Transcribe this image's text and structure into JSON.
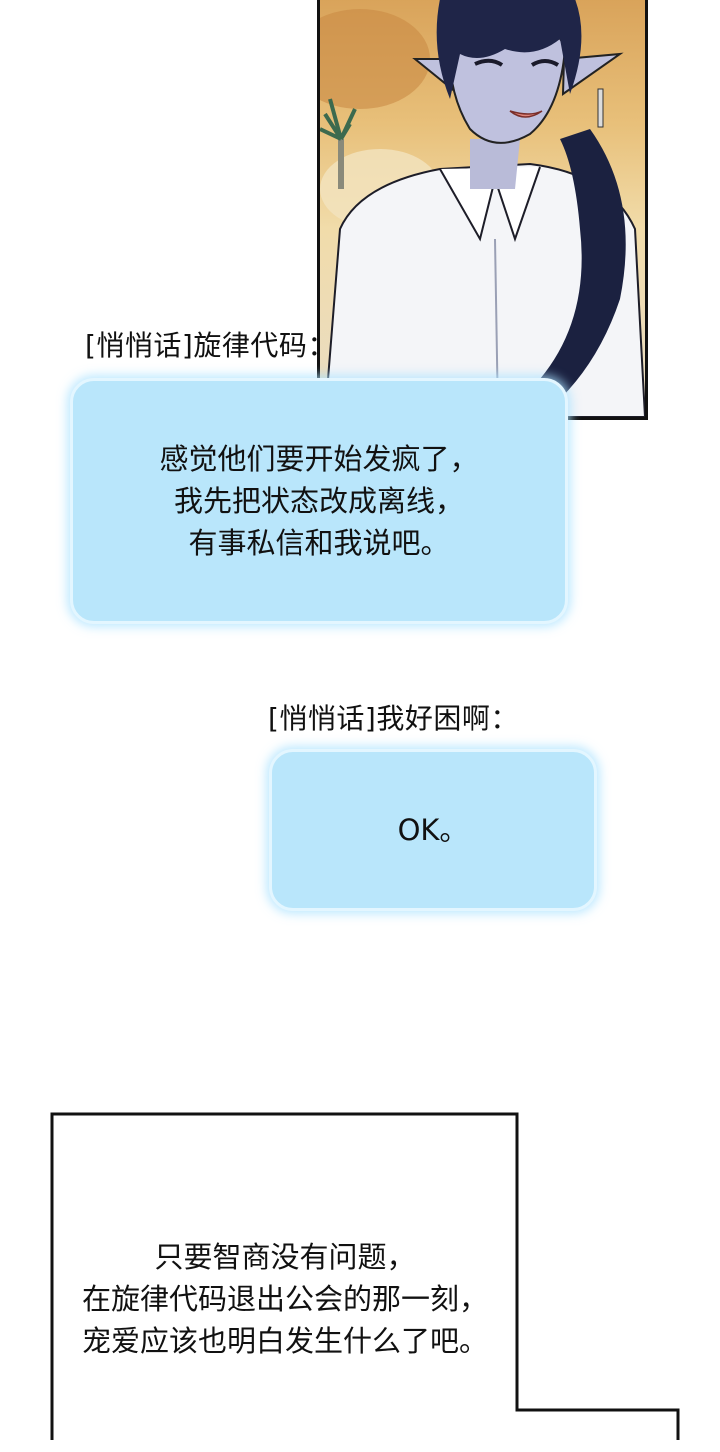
{
  "whisper_1": {
    "speaker": "[悄悄话]旋律代码：",
    "lines": [
      "感觉他们要开始发疯了，",
      "我先把状态改成离线，",
      "有事私信和我说吧。"
    ]
  },
  "whisper_2": {
    "speaker": "[悄悄话]我好困啊：",
    "lines": [
      "OK。"
    ]
  },
  "narration": {
    "lines": [
      "只要智商没有问题，",
      "在旋律代码退出公会的那一刻，",
      "宠爱应该也明白发生什么了吧。"
    ]
  },
  "colors": {
    "bubble_fill": "#b9e6fb",
    "bubble_glow": "#aee1ff",
    "panel_border": "#111111"
  }
}
